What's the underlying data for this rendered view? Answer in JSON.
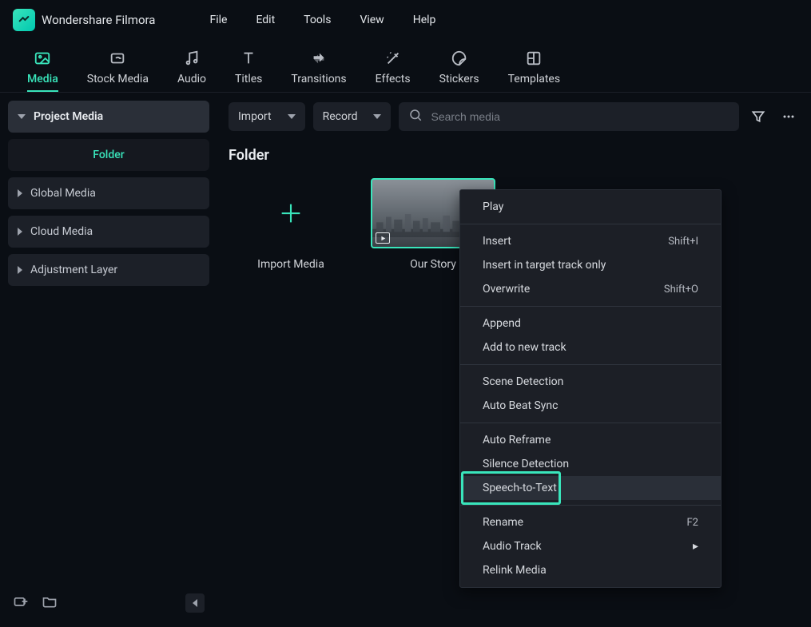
{
  "app": {
    "name": "Wondershare Filmora"
  },
  "menu": [
    "File",
    "Edit",
    "Tools",
    "View",
    "Help"
  ],
  "top_tabs": [
    {
      "id": "media",
      "label": "Media",
      "icon": "image"
    },
    {
      "id": "stock",
      "label": "Stock Media",
      "icon": "cloud-image"
    },
    {
      "id": "audio",
      "label": "Audio",
      "icon": "music"
    },
    {
      "id": "titles",
      "label": "Titles",
      "icon": "text"
    },
    {
      "id": "transitions",
      "label": "Transitions",
      "icon": "swap"
    },
    {
      "id": "effects",
      "label": "Effects",
      "icon": "sparkle"
    },
    {
      "id": "stickers",
      "label": "Stickers",
      "icon": "sticker"
    },
    {
      "id": "templates",
      "label": "Templates",
      "icon": "layout"
    }
  ],
  "active_tab": "media",
  "sidebar": {
    "header": "Project Media",
    "sub": "Folder",
    "items": [
      {
        "id": "global",
        "label": "Global Media"
      },
      {
        "id": "cloud",
        "label": "Cloud Media"
      },
      {
        "id": "adj",
        "label": "Adjustment Layer"
      }
    ]
  },
  "toolbar": {
    "import": "Import",
    "record": "Record",
    "search_placeholder": "Search media"
  },
  "content": {
    "folder_title": "Folder",
    "cards": {
      "import_label": "Import Media",
      "clip_label": "Our Story"
    }
  },
  "context_menu": {
    "groups": [
      [
        {
          "label": "Play",
          "shortcut": ""
        }
      ],
      [
        {
          "label": "Insert",
          "shortcut": "Shift+I"
        },
        {
          "label": "Insert in target track only",
          "shortcut": ""
        },
        {
          "label": "Overwrite",
          "shortcut": "Shift+O"
        }
      ],
      [
        {
          "label": "Append",
          "shortcut": ""
        },
        {
          "label": "Add to new track",
          "shortcut": ""
        }
      ],
      [
        {
          "label": "Scene Detection",
          "shortcut": ""
        },
        {
          "label": "Auto Beat Sync",
          "shortcut": ""
        }
      ],
      [
        {
          "label": "Auto Reframe",
          "shortcut": ""
        },
        {
          "label": "Silence Detection",
          "shortcut": ""
        },
        {
          "label": "Speech-to-Text",
          "shortcut": "",
          "hover": true,
          "highlight": true
        }
      ],
      [
        {
          "label": "Rename",
          "shortcut": "F2"
        },
        {
          "label": "Audio Track",
          "shortcut": "",
          "submenu": true
        },
        {
          "label": "Relink Media",
          "shortcut": ""
        }
      ]
    ]
  }
}
